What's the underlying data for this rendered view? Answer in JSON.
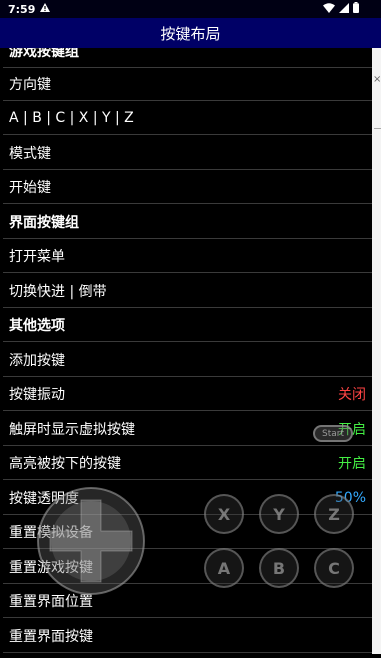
{
  "status_bar": {
    "time": "7:59"
  },
  "title_bar": {
    "title": "按键布局"
  },
  "list": {
    "rows": [
      {
        "label": "游戏按键组",
        "type": "header"
      },
      {
        "label": "方向键"
      },
      {
        "label": "A | B | C | X | Y | Z"
      },
      {
        "label": "模式键"
      },
      {
        "label": "开始键"
      },
      {
        "label": "界面按键组",
        "type": "header"
      },
      {
        "label": "打开菜单"
      },
      {
        "label": "切换快进 | 倒带"
      },
      {
        "label": "其他选项",
        "type": "header"
      },
      {
        "label": "添加按键"
      },
      {
        "label": "按键振动",
        "value": "关闭"
      },
      {
        "label": "触屏时显示虚拟按键",
        "value": "开启"
      },
      {
        "label": "高亮被按下的按键",
        "value": "开启"
      },
      {
        "label": "按键透明度",
        "value": "50%"
      },
      {
        "label": "重置模拟设备"
      },
      {
        "label": "重置游戏按键"
      },
      {
        "label": "重置界面位置"
      },
      {
        "label": "重置界面按键"
      }
    ]
  },
  "overlay": {
    "start_button": "Start",
    "buttons_top": [
      "X",
      "Y",
      "Z"
    ],
    "buttons_bottom": [
      "A",
      "B",
      "C"
    ]
  },
  "colors": {
    "title_bar_bg": "#000066",
    "value_off": "#ff4444",
    "value_on": "#44ee44",
    "value_percent": "#33aaff"
  },
  "icons": [
    "warning-icon",
    "wifi-icon",
    "signal-icon",
    "battery-icon",
    "dpad-icon",
    "close-icon"
  ]
}
